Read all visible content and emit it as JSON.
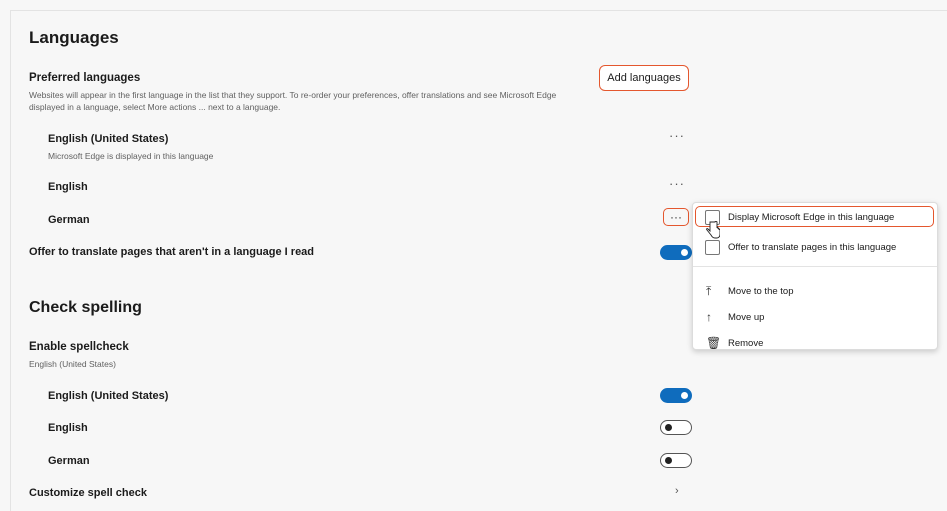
{
  "languages": {
    "heading": "Languages",
    "preferred_title": "Preferred languages",
    "preferred_desc": "Websites will appear in the first language in the list that they support. To re-order your preferences, offer translations and see Microsoft Edge displayed in a language, select More actions ... next to a language.",
    "add_button": "Add languages",
    "items": [
      {
        "name": "English (United States)",
        "sub": "Microsoft Edge is displayed in this language"
      },
      {
        "name": "English"
      },
      {
        "name": "German"
      }
    ],
    "more_glyph": "···",
    "offer_translate": "Offer to translate pages that aren't in a language I read",
    "offer_translate_on": true
  },
  "context_menu": {
    "items": [
      {
        "label": "Display Microsoft Edge in this language",
        "icon": "checkbox-icon"
      },
      {
        "label": "Offer to translate pages in this language",
        "icon": "checkbox-icon"
      },
      {
        "label": "Move to the top",
        "icon": "move-to-top-icon"
      },
      {
        "label": "Move up",
        "icon": "arrow-up-icon"
      },
      {
        "label": "Remove",
        "icon": "trash-icon"
      }
    ]
  },
  "spelling": {
    "heading": "Check spelling",
    "enable_title": "Enable spellcheck",
    "enable_sub": "English (United States)",
    "items": [
      {
        "name": "English (United States)",
        "on": true
      },
      {
        "name": "English",
        "on": false
      },
      {
        "name": "German",
        "on": false
      }
    ],
    "customize": "Customize spell check"
  },
  "colors": {
    "accent": "#0f6cbd",
    "highlight": "#e4572e"
  }
}
